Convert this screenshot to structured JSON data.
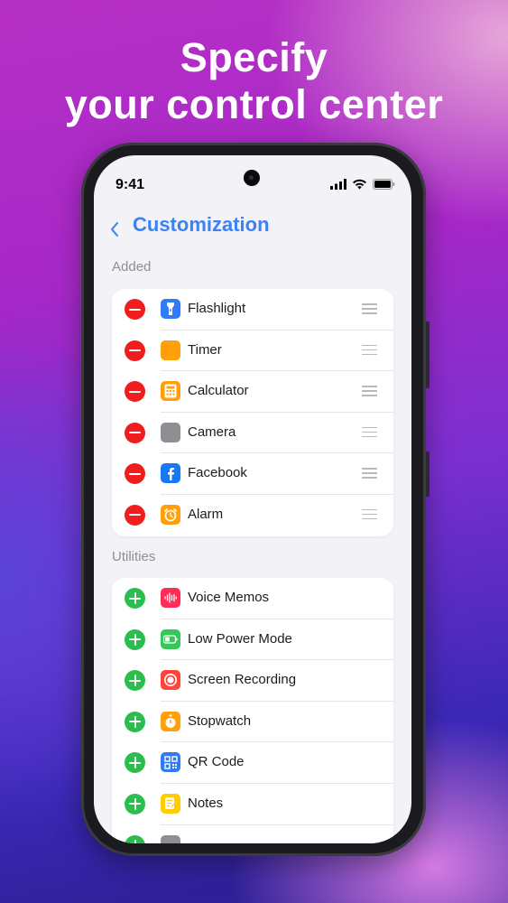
{
  "headline": {
    "line1": "Specify",
    "line2": "your control center"
  },
  "status_bar": {
    "time": "9:41"
  },
  "nav": {
    "back_glyph": "‹",
    "title": "Customization"
  },
  "sections": {
    "added": {
      "label": "Added",
      "items": [
        {
          "label": "Flashlight",
          "icon": "flashlight-icon",
          "color": "#2f7cf6"
        },
        {
          "label": "Timer",
          "icon": "timer-icon",
          "color": "#ff9f0a"
        },
        {
          "label": "Calculator",
          "icon": "calculator-icon",
          "color": "#ff9f0a"
        },
        {
          "label": "Camera",
          "icon": "camera-icon",
          "color": "#8e8e93"
        },
        {
          "label": "Facebook",
          "icon": "facebook-icon",
          "color": "#1877f2"
        },
        {
          "label": "Alarm",
          "icon": "alarm-icon",
          "color": "#ff9f0a"
        }
      ]
    },
    "utilities": {
      "label": "Utilities",
      "items": [
        {
          "label": "Voice Memos",
          "icon": "voice-memos-icon",
          "color": "#ff2d55"
        },
        {
          "label": "Low Power Mode",
          "icon": "battery-icon",
          "color": "#34c759"
        },
        {
          "label": "Screen Recording",
          "icon": "screen-recording-icon",
          "color": "#ff453a"
        },
        {
          "label": "Stopwatch",
          "icon": "stopwatch-icon",
          "color": "#ff9f0a"
        },
        {
          "label": "QR Code",
          "icon": "qr-code-icon",
          "color": "#2f7cf6"
        },
        {
          "label": "Notes",
          "icon": "notes-icon",
          "color": "#ffcc00"
        }
      ]
    }
  },
  "colors": {
    "accent": "#3b82f6",
    "remove": "#ef1d1d",
    "add": "#2bbd4e"
  }
}
